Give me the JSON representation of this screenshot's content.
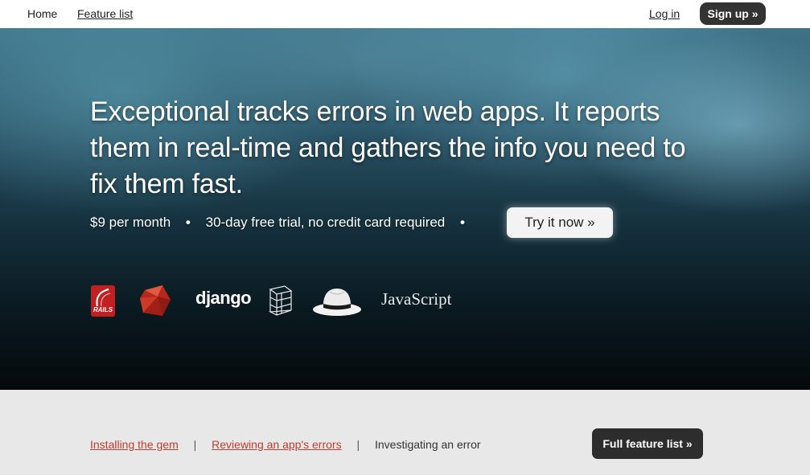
{
  "nav": {
    "home": "Home",
    "features": "Feature list",
    "login": "Log in",
    "signup": "Sign up »"
  },
  "hero": {
    "title": "Exceptional tracks errors in web apps. It reports them in real-time and gathers the info you need to fix them fast.",
    "price": "$9 per month",
    "bullet": "•",
    "trial": "30-day free trial, no credit card required",
    "cta": "Try it now »"
  },
  "logos": {
    "rails_text": "RAILS",
    "django": "django",
    "javascript": "JavaScript"
  },
  "bottom": {
    "link1": "Installing the gem",
    "separator": "|",
    "link2": "Reviewing an app's errors",
    "current": "Investigating an error",
    "full_button": "Full feature list »"
  },
  "colors": {
    "link_red": "#c23b2e",
    "dark_button": "#333333",
    "rails_red": "#c02020"
  }
}
